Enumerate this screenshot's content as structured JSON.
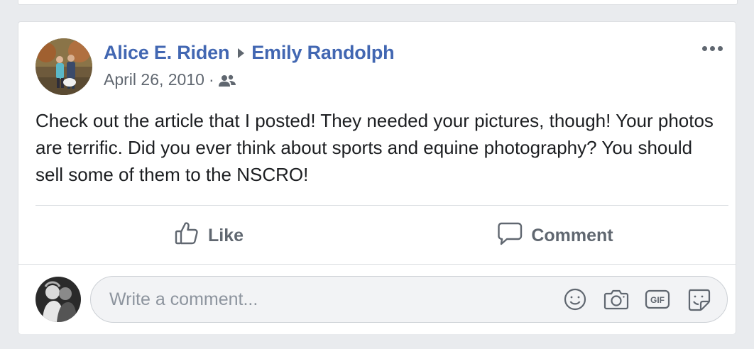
{
  "post": {
    "author": "Alice E. Riden",
    "recipient": "Emily Randolph",
    "date": "April 26, 2010",
    "separator": "·",
    "audience_icon": "friends-icon",
    "text": "Check out the article that I posted! They needed your pictures, though! Your photos are terrific. Did you ever think about sports and equine photography? You should sell some of them to the NSCRO!"
  },
  "actions": {
    "like_label": "Like",
    "comment_label": "Comment"
  },
  "comment_box": {
    "placeholder": "Write a comment...",
    "icons": [
      "emoji-icon",
      "camera-icon",
      "gif-icon",
      "sticker-icon"
    ]
  },
  "colors": {
    "link": "#4267b2",
    "secondary_text": "#606770",
    "background": "#e9ebee"
  }
}
